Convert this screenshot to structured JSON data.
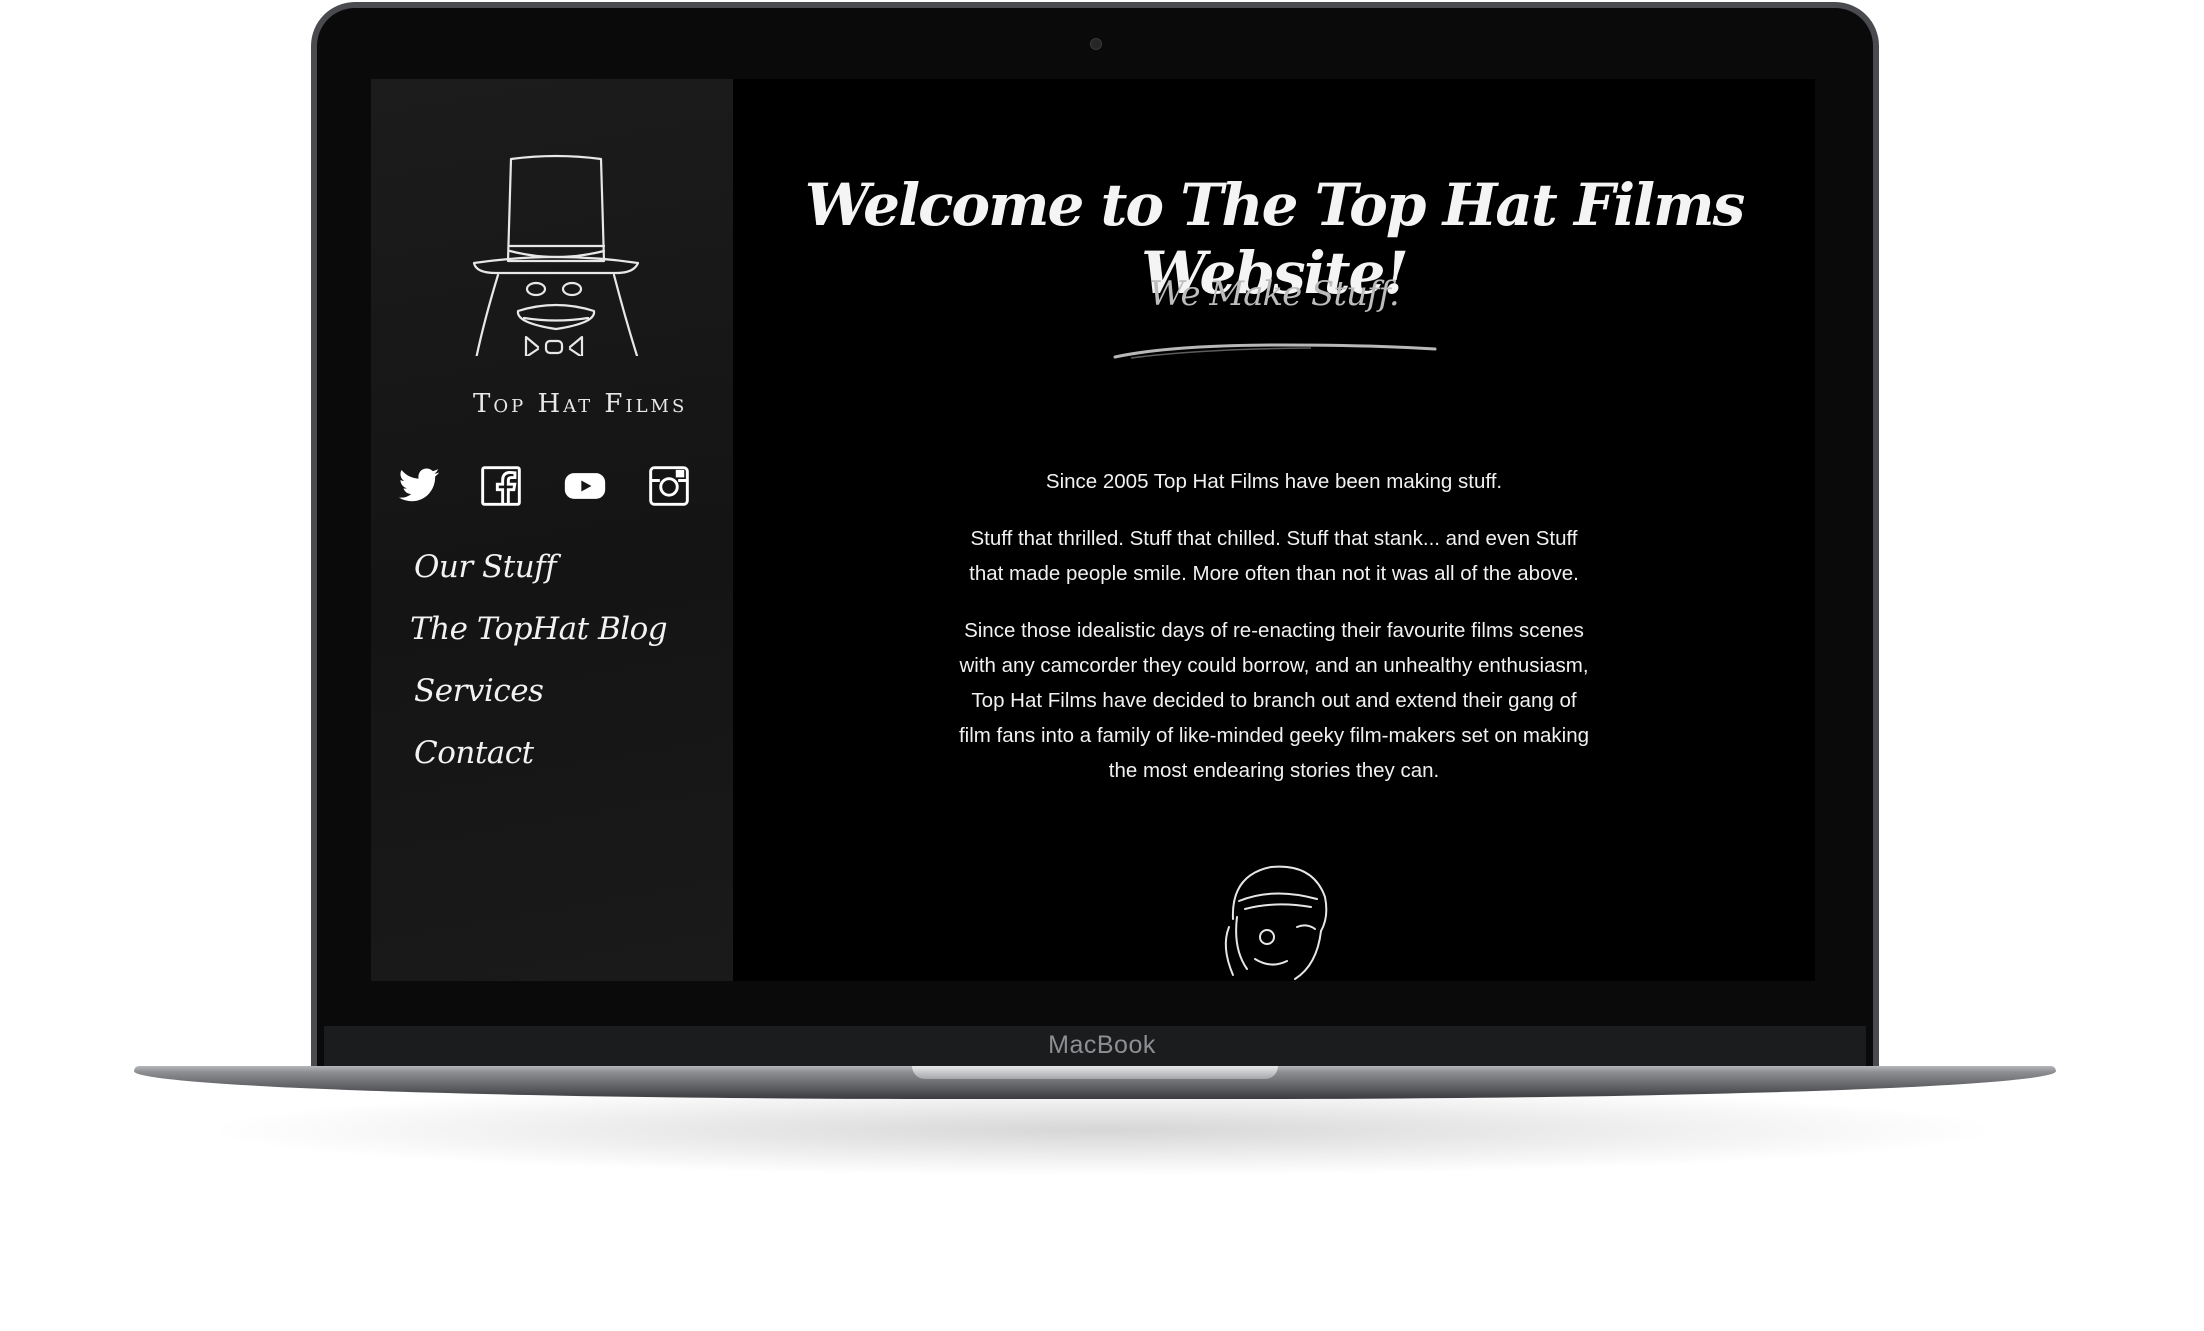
{
  "device": {
    "label": "MacBook"
  },
  "site": {
    "logo_text": "Top Hat Films",
    "social": [
      {
        "name": "twitter-icon"
      },
      {
        "name": "facebook-icon"
      },
      {
        "name": "youtube-icon"
      },
      {
        "name": "instagram-icon"
      }
    ],
    "nav": [
      {
        "label": "Our Stuff"
      },
      {
        "label": "The TopHat Blog"
      },
      {
        "label": "Services"
      },
      {
        "label": "Contact"
      }
    ],
    "title": "Welcome to The Top Hat Films Website!",
    "subtitle": "We Make Stuff.",
    "paragraphs": [
      "Since 2005 Top Hat Films have been making stuff.",
      "Stuff that thrilled. Stuff that chilled. Stuff that stank... and even Stuff that made people smile. More often than not it was all of the above.",
      "Since those idealistic days of re-enacting their favourite films scenes with any camcorder they could borrow, and an unhealthy enthusiasm, Top Hat Films have decided to branch out and extend their gang of film fans into a family of like-minded geeky film-makers set on making the most endearing stories they can."
    ]
  },
  "colors": {
    "background": "#000000",
    "sidebar": "#161616",
    "text": "#f2f2f2",
    "subtitle": "#bcbcbc"
  }
}
